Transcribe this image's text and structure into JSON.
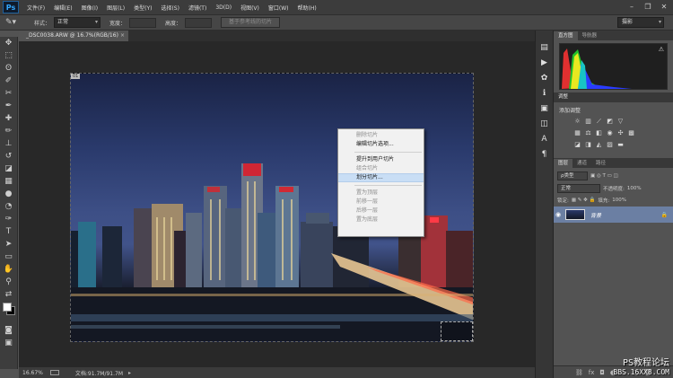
{
  "app": {
    "logo": "Ps"
  },
  "menu": [
    "文件(F)",
    "编辑(E)",
    "图像(I)",
    "图层(L)",
    "类型(Y)",
    "选择(S)",
    "滤镜(T)",
    "3D(D)",
    "视图(V)",
    "窗口(W)",
    "帮助(H)"
  ],
  "options": {
    "style_label": "样式：",
    "style_value": "正常",
    "width_label": "宽度：",
    "height_label": "高度：",
    "guides_button": "基于参考线的切片",
    "workspace": "摄影"
  },
  "document": {
    "tab_title": "_DSC0038.ARW @ 16.7%(RGB/16)",
    "slice_tag": "01",
    "zoom": "16.67%",
    "doc_info": "文档:91.7M/91.7M"
  },
  "context_menu": {
    "items": [
      {
        "label": "删除切片",
        "disabled": true,
        "hover": false
      },
      {
        "label": "编辑切片选项...",
        "disabled": false,
        "hover": false
      },
      {
        "sep": true
      },
      {
        "label": "提升到用户切片",
        "disabled": false,
        "hover": false
      },
      {
        "label": "组合切片",
        "disabled": true,
        "hover": false
      },
      {
        "label": "划分切片...",
        "disabled": false,
        "hover": true
      },
      {
        "sep": true
      },
      {
        "label": "置为顶层",
        "disabled": true,
        "hover": false
      },
      {
        "label": "前移一层",
        "disabled": true,
        "hover": false
      },
      {
        "label": "后移一层",
        "disabled": true,
        "hover": false
      },
      {
        "label": "置为底层",
        "disabled": true,
        "hover": false
      }
    ]
  },
  "panels": {
    "histogram_tabs": [
      "直方图",
      "导航器"
    ],
    "adjustments_tab": "调整",
    "adjustments_subtitle": "添加调整",
    "layers_tabs": [
      "图层",
      "通道",
      "路径"
    ],
    "kind_label": "ρ类型",
    "blend_mode": "正常",
    "opacity_label": "不透明度:",
    "opacity_value": "100%",
    "lock_label": "锁定:",
    "fill_label": "填充:",
    "fill_value": "100%",
    "layer_name": "背景"
  },
  "watermark": {
    "line1": "PS教程论坛",
    "line2": "BBS.16XX8.COM"
  },
  "colors": {
    "selected_layer": "#6b7fa3",
    "menu_hover": "#c9def5"
  }
}
